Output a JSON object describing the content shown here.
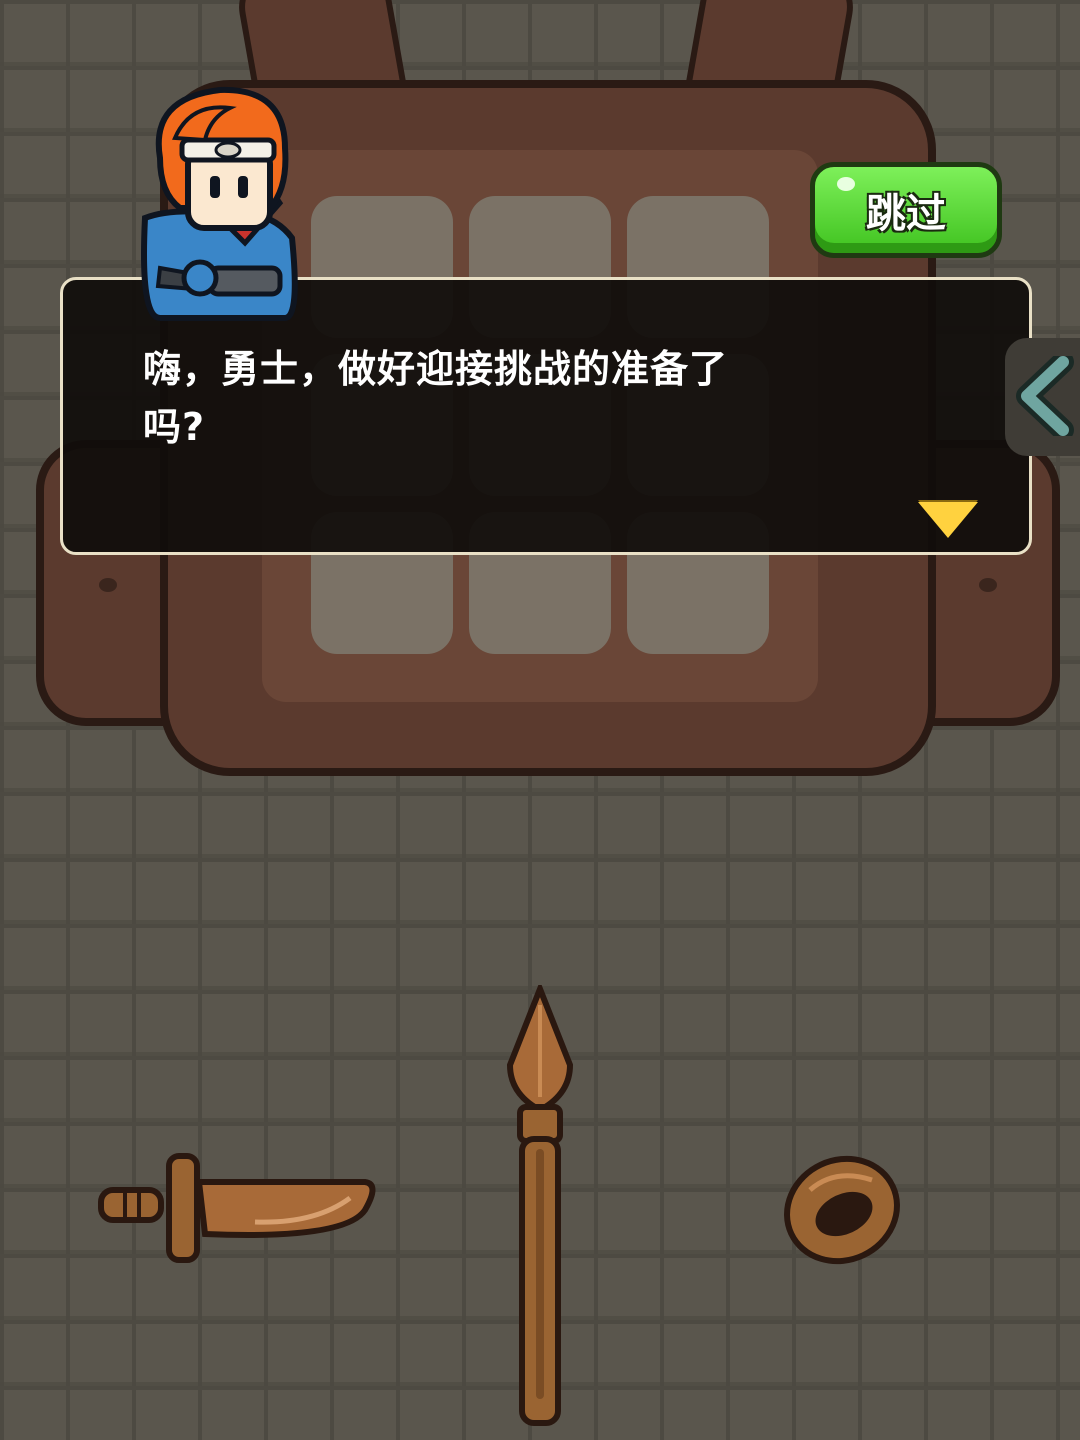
{
  "dialog": {
    "line1": "嗨，勇士，做好迎接挑战的准备了",
    "line2": "吗?"
  },
  "buttons": {
    "skip_label": "跳过"
  },
  "backpack": {
    "slots": 9
  },
  "items": [
    "sword-icon",
    "spear-icon",
    "ring-icon"
  ],
  "colors": {
    "skip_button": "#49d22a",
    "next_arrow": "#ffd23f",
    "dialog_border": "#e9e0c6"
  }
}
